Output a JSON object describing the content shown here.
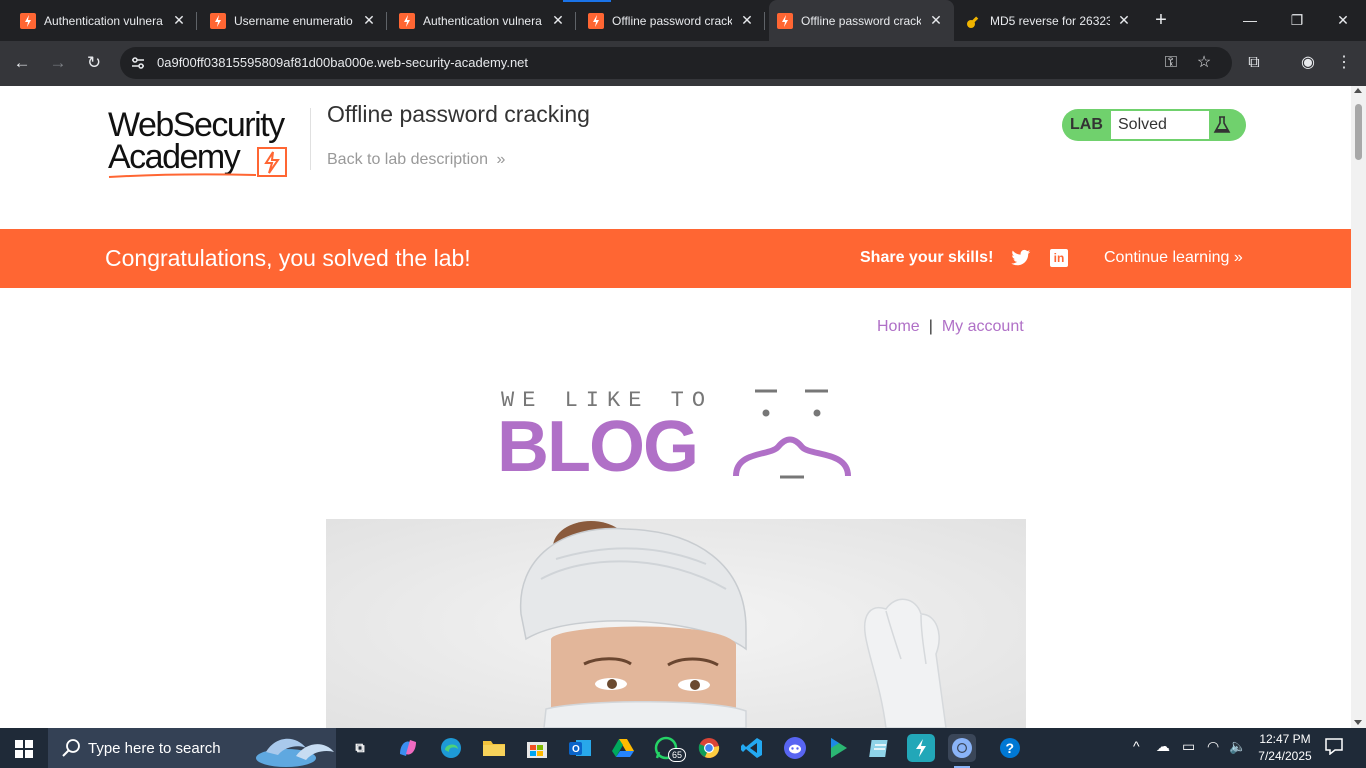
{
  "browser": {
    "tabs": [
      {
        "title": "Authentication vulnera",
        "active": false
      },
      {
        "title": "Username enumeratio",
        "active": false
      },
      {
        "title": "Authentication vulnera",
        "active": false
      },
      {
        "title": "Offline password crack",
        "active": false
      },
      {
        "title": "Offline password crack",
        "active": true
      },
      {
        "title": "MD5 reverse for 26323",
        "active": false
      }
    ],
    "url": "0a9f00ff03815595809af81d00ba000e.web-security-academy.net"
  },
  "header": {
    "logo_line1": "WebSecurity",
    "logo_line2": "Academy",
    "lab_title": "Offline password cracking",
    "back_link": "Back to lab description",
    "back_chevron": "»",
    "lab_badge": "LAB",
    "lab_status": "Solved"
  },
  "banner": {
    "message": "Congratulations, you solved the lab!",
    "share": "Share your skills!",
    "continue": "Continue learning",
    "continue_chevron": "»",
    "color": "#ff6633"
  },
  "blog": {
    "nav_home": "Home",
    "nav_sep": "|",
    "nav_account": "My account",
    "tagline": "WE LIKE TO",
    "title": "BLOG"
  },
  "taskbar": {
    "search_placeholder": "Type here to search",
    "whatsapp_badge": "65",
    "time": "12:47 PM",
    "date": "7/24/2025"
  },
  "colors": {
    "accent_orange": "#ff6633",
    "solved_green": "#70d16d",
    "blog_purple": "#b070c7"
  }
}
